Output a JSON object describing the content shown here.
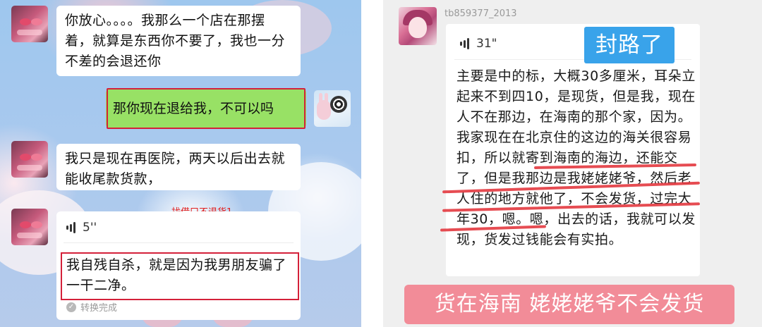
{
  "left_chat": {
    "message_1": "你放心。。。。我那么一个店在那摆着，就算是东西你不要了，我也一分不差的会退还你",
    "message_reply": "那你现在退给我，不可以吗",
    "message_2": "我只是现在再医院，两天以后出去就能收尾款货款，",
    "annotation": "找借口不退货1",
    "voice": {
      "duration": "5''",
      "transcript": "我自残自杀，就是因为我男朋友骗了一干二净。",
      "status": "转换完成"
    }
  },
  "right_chat": {
    "username": "tb859377_2013",
    "voice_duration": "31\"",
    "transcript": "主要是中的标，大概30多厘米，耳朵立起来不到四10，是现货，但是我，现在人不在那边，在海南的那个家，因为。我家现在在北京住的这边的海关很容易扣，所以就寄到海南的海边，还能交了，但是我那边是我姥姥姥爷，然后老人住的地方就他了，不会发货，过完大年30，嗯。嗯，出去的话，我就可以发现，货发过钱能会有实拍。",
    "tag_top": "封路了",
    "tag_bottom": "货在海南 姥姥姥爷不会发货"
  },
  "colors": {
    "wechat_green": "#98e165",
    "annotation_red": "#d4213a",
    "tag_blue": "#39a3ea",
    "tag_pink": "#f28c98",
    "strike_red": "#e3393f"
  },
  "icons": [
    "voice-wave-icon",
    "check-circle-icon"
  ]
}
